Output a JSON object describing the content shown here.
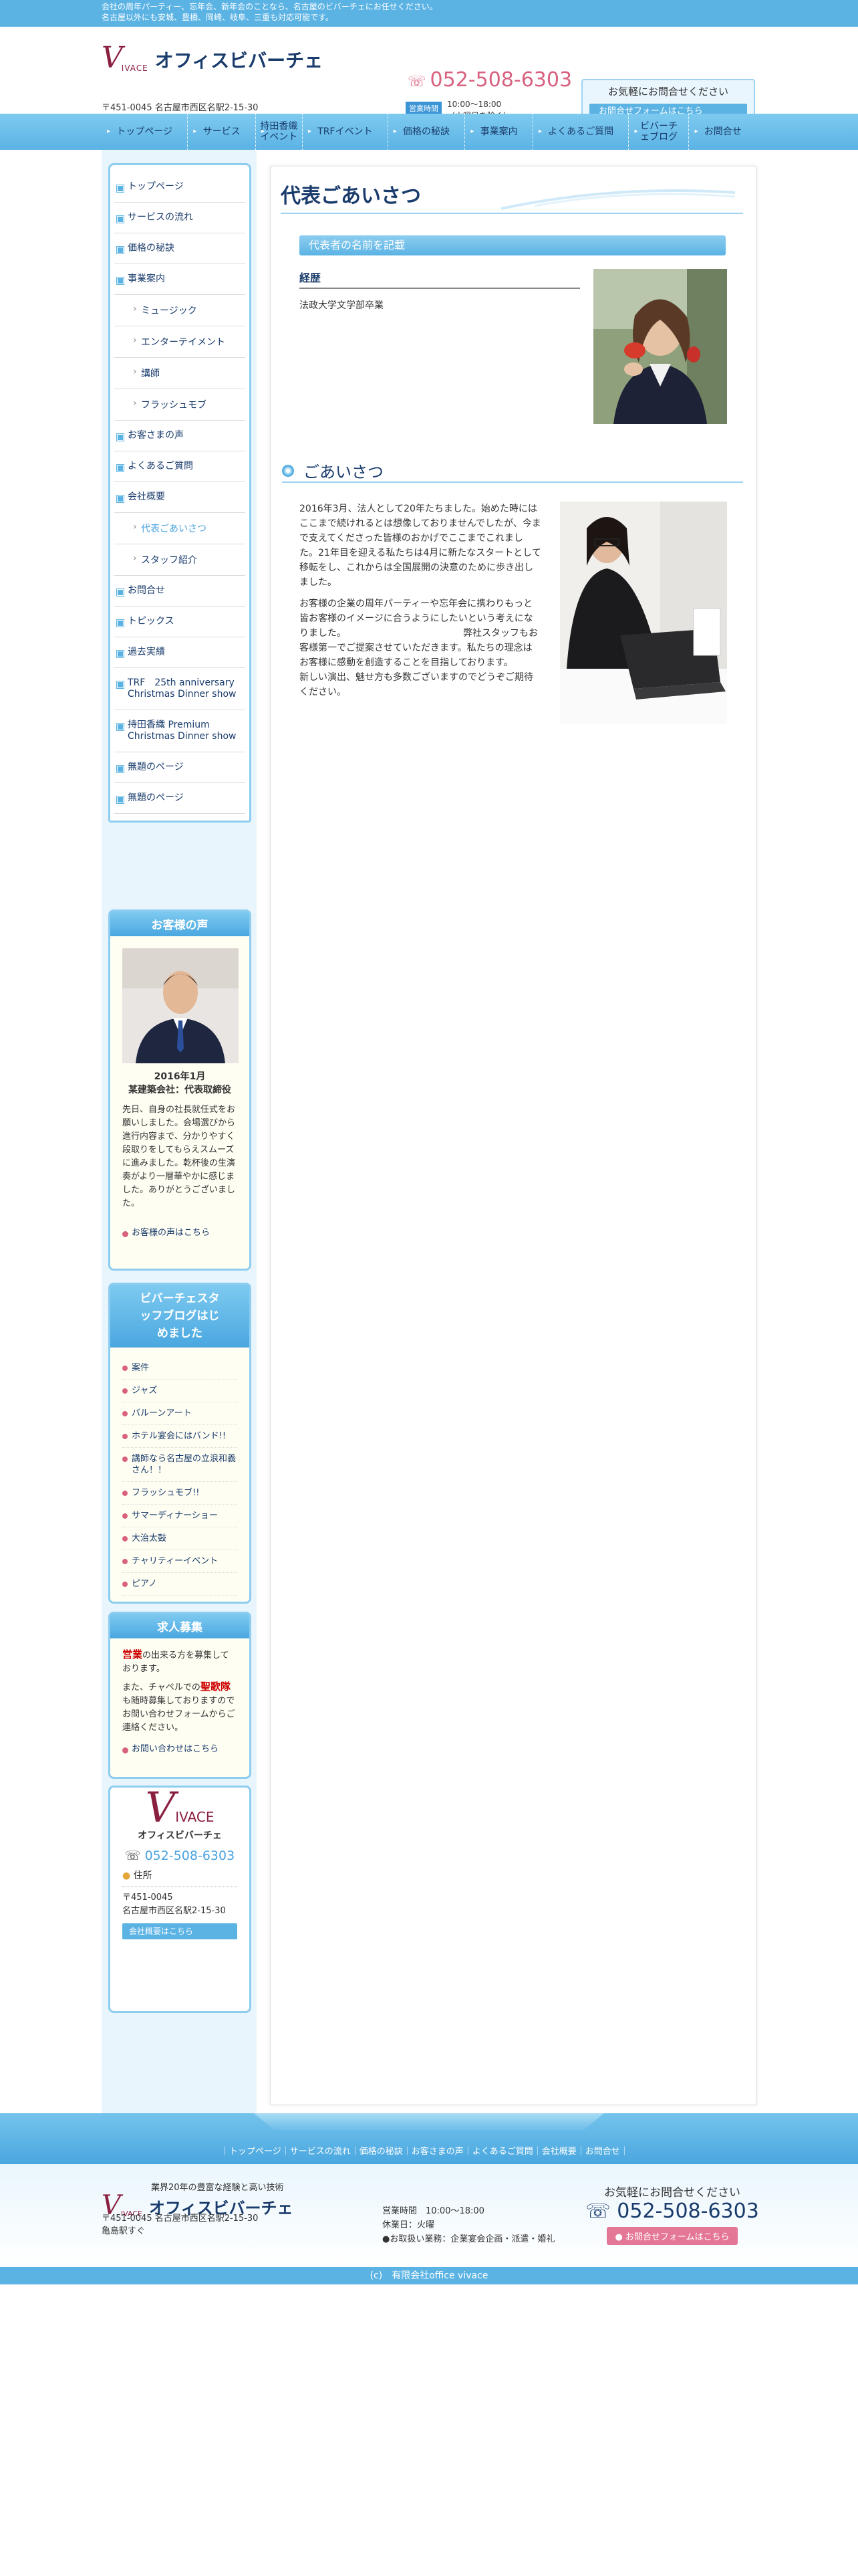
{
  "topbar": {
    "line1": "会社の周年パーティー、忘年会、新年会のことなら、名古屋のビバーチェにお任せください。",
    "line2": "名古屋以外にも安城、豊橋、岡崎、岐阜、三重も対応可能です。"
  },
  "header": {
    "logo_letter": "V",
    "logo_rest": "IVACE",
    "company": "オフィスビバーチェ",
    "address": "〒451-0045 名古屋市西区名駅2-15-30",
    "phone": "052-508-6303",
    "hours_badge": "営業時間",
    "hours": "10:00〜18:00",
    "hours_note": "（火曜日を除く）",
    "contact_title": "お気軽にお問合せください",
    "contact_button": "お問合せフォームはこちら"
  },
  "gnav": [
    "トップページ",
    "サービス",
    "持田香織イベント",
    "TRFイベント",
    "価格の秘訣",
    "事業案内",
    "よくあるご質問",
    "ビバーチェブログ",
    "お問合せ"
  ],
  "sidenav": [
    {
      "label": "トップページ",
      "sub": false
    },
    {
      "label": "サービスの流れ",
      "sub": false
    },
    {
      "label": "価格の秘訣",
      "sub": false
    },
    {
      "label": "事業案内",
      "sub": false
    },
    {
      "label": "ミュージック",
      "sub": true
    },
    {
      "label": "エンターテイメント",
      "sub": true
    },
    {
      "label": "講師",
      "sub": true
    },
    {
      "label": "フラッシュモブ",
      "sub": true
    },
    {
      "label": "お客さまの声",
      "sub": false
    },
    {
      "label": "よくあるご質問",
      "sub": false
    },
    {
      "label": "会社概要",
      "sub": false
    },
    {
      "label": "代表ごあいさつ",
      "sub": true,
      "active": true
    },
    {
      "label": "スタッフ紹介",
      "sub": true
    },
    {
      "label": "お問合せ",
      "sub": false
    },
    {
      "label": "トピックス",
      "sub": false
    },
    {
      "label": "過去実績",
      "sub": false
    },
    {
      "label": "TRF　25th anniversary Christmas Dinner show",
      "sub": false
    },
    {
      "label": "持田香織 Premium Christmas Dinner show",
      "sub": false
    },
    {
      "label": "無題のページ",
      "sub": false
    },
    {
      "label": "無題のページ",
      "sub": false
    }
  ],
  "voice": {
    "title": "お客様の声",
    "date": "2016年1月",
    "who": "某建築会社：代表取締役",
    "text": "先日、自身の社長就任式をお願いしました。会場選びから進行内容まで、分かりやすく段取りをしてもらえスムーズに進みました。乾杯後の生演奏がより一層華やかに感じました。ありがとうございました。",
    "link": "お客様の声はこちら"
  },
  "blog": {
    "title": "ビバーチェスタッフブログはじめました",
    "items": [
      "案件",
      "ジャズ",
      "バルーンアート",
      "ホテル宴会にはバンド!!",
      "講師なら名古屋の立浪和義さん！！",
      "フラッシュモブ!!",
      "サマーディナーショー",
      "大治太鼓",
      "チャリティーイベント",
      "ピアノ"
    ]
  },
  "recruit": {
    "title": "求人募集",
    "w1": "営業",
    "t1": "の出来る方を募集しております。",
    "t2": "また、チャペルでの",
    "w2": "聖歌隊",
    "t3": "も随時募集しておりますのでお問い合わせフォームからご連絡ください。",
    "link": "お問い合わせはこちら"
  },
  "sidecompany": {
    "name": "オフィスビバーチェ",
    "phone": "052-508-6303",
    "addr_label": "住所",
    "zip": "〒451-0045",
    "addr": "名古屋市西区名駅2-15-30",
    "button": "会社概要はこちら"
  },
  "main": {
    "title": "代表ごあいさつ",
    "section_bar": "代表者の名前を記載",
    "career_head": "経歴",
    "career": "法政大学文学部卒業",
    "greet_title": "ごあいさつ",
    "p1": "2016年3月、法人として20年たちました。始めた時にはここまで続けれるとは想像しておりませんでしたが、今まで支えてくださった皆様のおかげでここまでこれました。21年目を迎える私たちは4月に新たなスタートとして移転をし、これからは全国展開の決意のために歩き出しました。",
    "p2": "お客様の企業の周年パーティーや忘年会に携わりもっと皆お客様のイメージに合うようにしたいという考えになりました。　　　　　　　　　　　　　弊社スタッフもお客様第一でご提案させていただきます。私たちの理念はお客様に感動を創造することを目指しております。　　　　　　　　　　　　　　新しい演出、魅せ方も多数ございますのでどうぞご期待ください。"
  },
  "footer": {
    "nav": "｜トップページ｜サービスの流れ｜価格の秘訣｜お客さまの声｜よくあるご質問｜会社概要｜お問合せ｜",
    "tagline": "業界20年の豊富な経験と高い技術",
    "company": "オフィスビバーチェ",
    "addr": "〒451-0045 名古屋市西区名駅2-15-30",
    "station": "亀島駅すぐ",
    "hours": "営業時間　10:00〜18:00",
    "closed": "休業日：火曜",
    "biz": "●お取扱い業務：企業宴会企画・派遣・婚礼",
    "call_title": "お気軽にお問合せください",
    "phone": "052-508-6303",
    "button": "お問合せフォームはこちら",
    "copyright": "(c)　有限会社office vivace"
  }
}
